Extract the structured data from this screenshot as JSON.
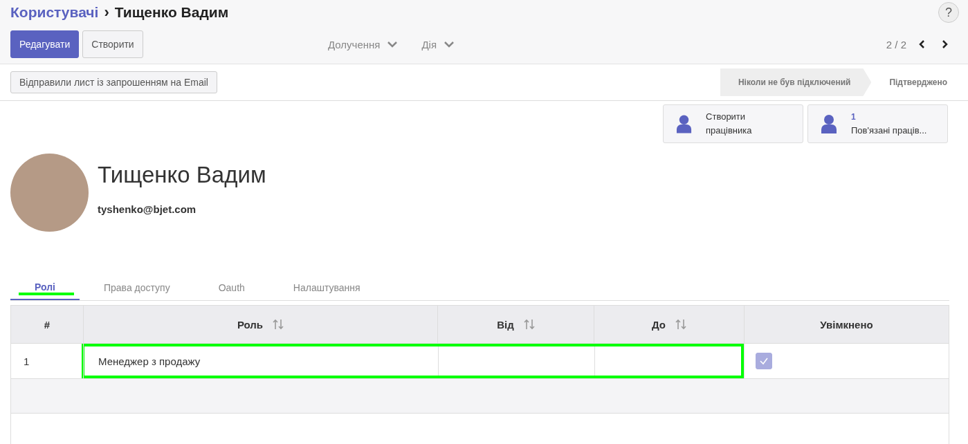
{
  "breadcrumb": {
    "parent": "Користувачі",
    "separator": "›",
    "current": "Тищенко Вадим"
  },
  "help": "?",
  "buttons": [
    {
      "label": "Редагувати",
      "primary": true
    },
    {
      "label": "Створити",
      "primary": false
    }
  ],
  "dropdowns": [
    "Долучення",
    "Дія"
  ],
  "pager": "2 / 2",
  "invite_button": "Відправили лист із запрошенням на Email",
  "stages": [
    {
      "label": "Ніколи не був підключений",
      "selected": true
    },
    {
      "label": "Підтверджено",
      "selected": false
    }
  ],
  "smart_buttons": [
    {
      "label": "Створити працівника"
    },
    {
      "value": "1",
      "label": "Пов'язані праців..."
    }
  ],
  "user": {
    "name": "Тищенко Вадим",
    "email": "tyshenko@bjet.com"
  },
  "tabs": [
    {
      "label": "Ролі",
      "selected": true,
      "highlighted": true
    },
    {
      "label": "Права доступу",
      "selected": false,
      "highlighted": false
    },
    {
      "label": "Oauth",
      "selected": false,
      "highlighted": false
    },
    {
      "label": "Налаштування",
      "selected": false,
      "highlighted": false
    }
  ],
  "table": {
    "columns": [
      {
        "label": "#",
        "sortable": false
      },
      {
        "label": "Роль",
        "sortable": true
      },
      {
        "label": "Від",
        "sortable": true
      },
      {
        "label": "До",
        "sortable": true
      },
      {
        "label": "Увімкнено",
        "sortable": false
      }
    ],
    "rows": [
      {
        "index": "1",
        "role": "Менеджер з продажу",
        "enabled": true,
        "highlighted": true
      }
    ]
  }
}
